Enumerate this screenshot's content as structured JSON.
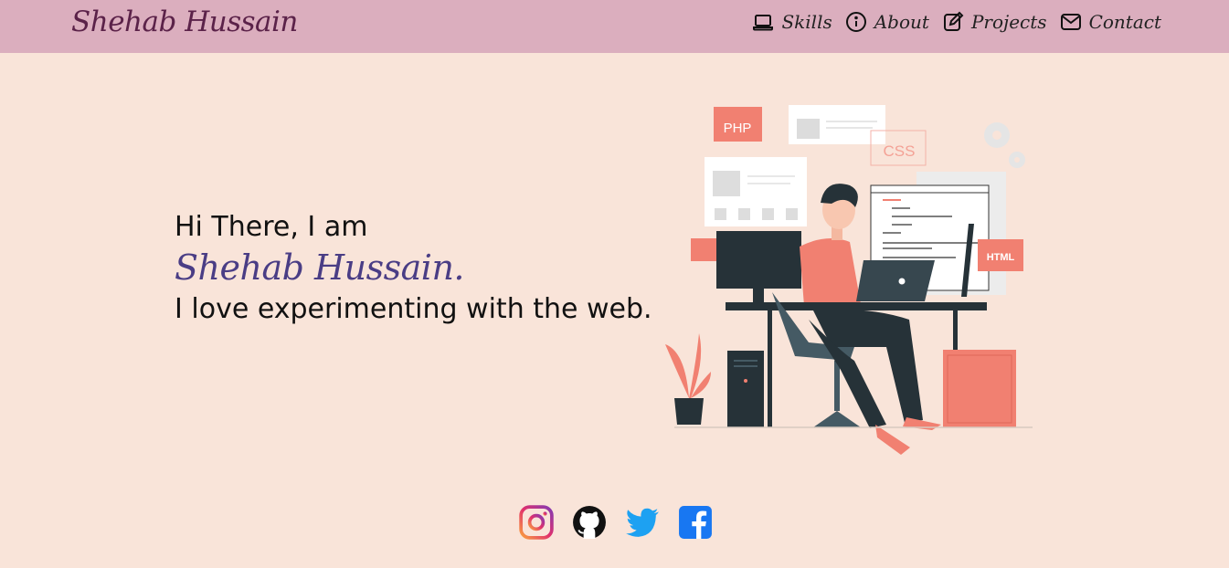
{
  "brand": "Shehab Hussain",
  "nav": [
    {
      "label": "Skills",
      "icon": "laptop-icon"
    },
    {
      "label": "About",
      "icon": "info-icon"
    },
    {
      "label": "Projects",
      "icon": "edit-icon"
    },
    {
      "label": "Contact",
      "icon": "envelope-icon"
    }
  ],
  "hero": {
    "greeting": "Hi There, I am",
    "name": "Shehab Hussain.",
    "tagline": "I love experimenting with the web."
  },
  "illustration": {
    "php_label": "PHP",
    "css_label": "CSS",
    "html_label": "HTML"
  },
  "socials": [
    {
      "name": "Instagram",
      "icon": "instagram-icon"
    },
    {
      "name": "GitHub",
      "icon": "github-icon"
    },
    {
      "name": "Twitter",
      "icon": "twitter-icon"
    },
    {
      "name": "Facebook",
      "icon": "facebook-icon"
    }
  ],
  "colors": {
    "background": "#f9e4d9",
    "navbar": "#dbaebe",
    "brand": "#5b2249",
    "name_accent": "#4a3d85",
    "coral": "#f18071"
  }
}
